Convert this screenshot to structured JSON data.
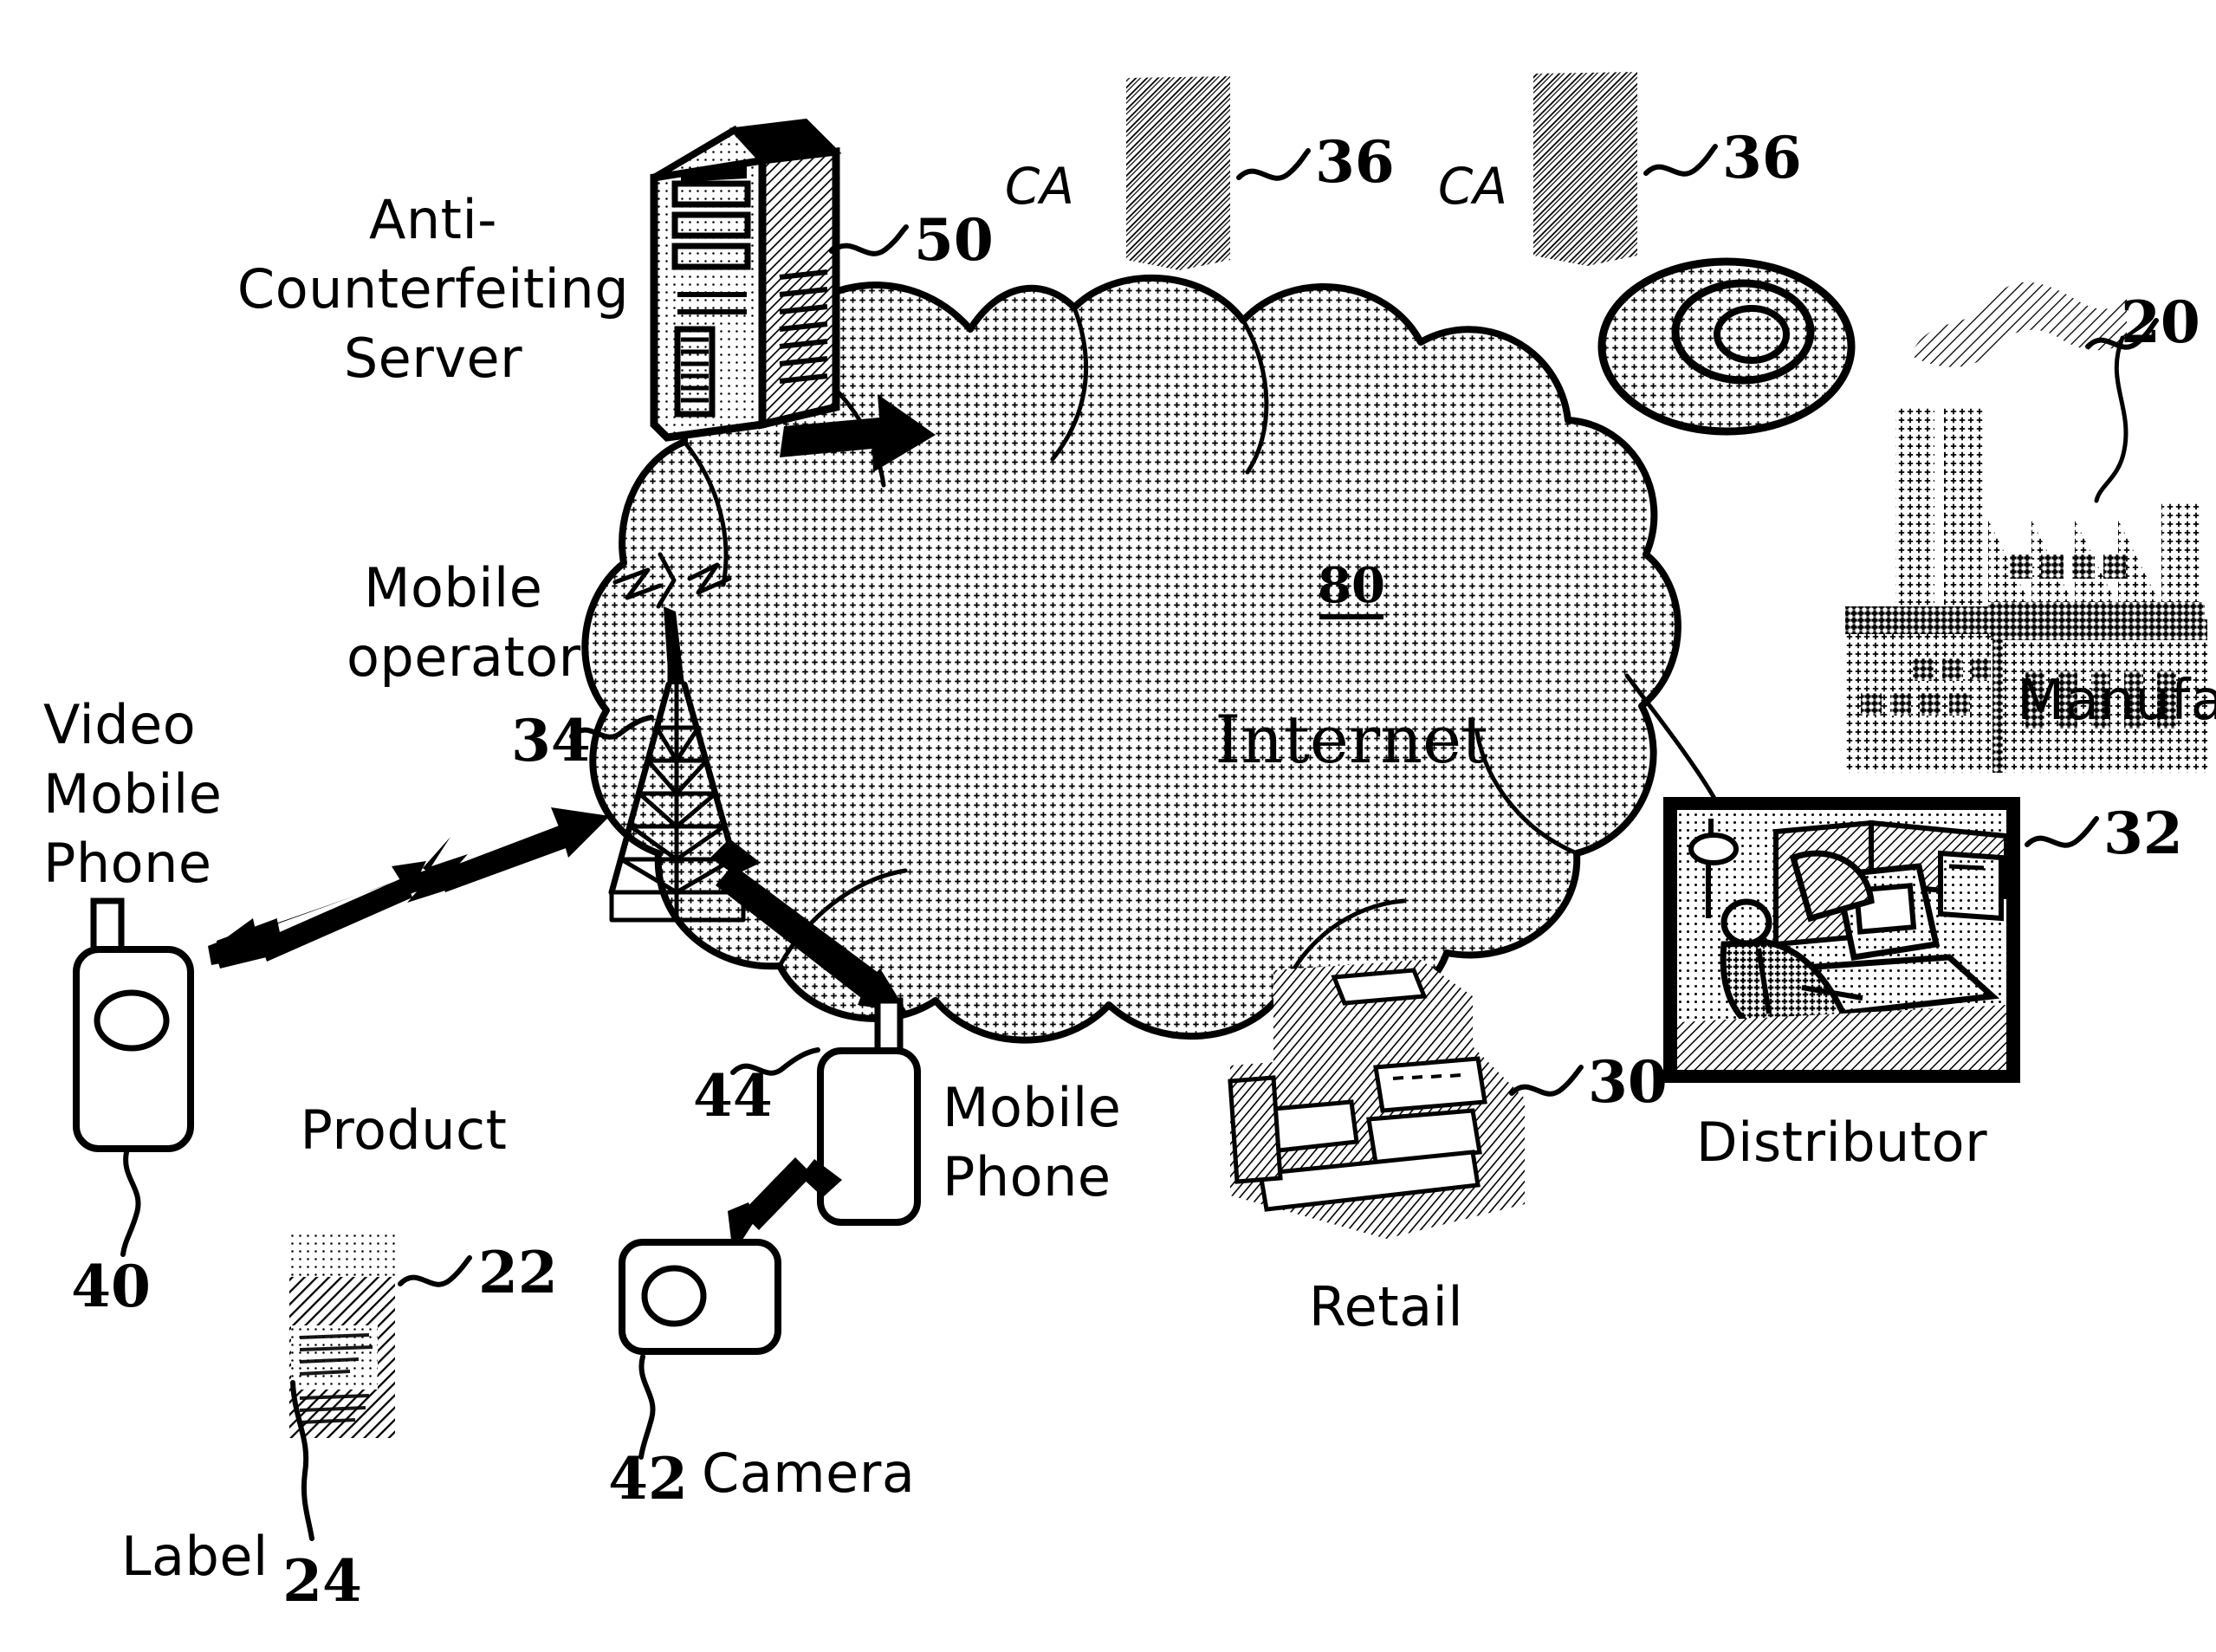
{
  "figure": {
    "kind": "patent-network-diagram",
    "background_color": "#ffffff",
    "ink_color": "#000000"
  },
  "cloud": {
    "name": "Internet",
    "label": "Internet",
    "ref": "80",
    "fill": "halftone-dot"
  },
  "nodes": [
    {
      "id": "server",
      "label": "Anti-\nCounterfeiting\nServer",
      "label_lines": [
        "Anti-",
        "Counterfeiting",
        "Server"
      ],
      "ref": "50",
      "icon": "tower-server-icon"
    },
    {
      "id": "ca_left",
      "label": "CA",
      "ref": "36",
      "icon": "certificate-authority-server-icon"
    },
    {
      "id": "ca_right",
      "label": "CA",
      "ref": "36",
      "icon": "certificate-authority-server-icon"
    },
    {
      "id": "manufacturer",
      "label": "Manufacturer",
      "ref": "20",
      "icon": "factory-icon"
    },
    {
      "id": "distributor",
      "label": "Distributor",
      "ref": "32",
      "icon": "warehouse-office-photo-icon"
    },
    {
      "id": "retail",
      "label": "Retail",
      "ref": "30",
      "icon": "cash-register-icon"
    },
    {
      "id": "mobile_operator",
      "label": "Mobile\noperator",
      "label_lines": [
        "Mobile",
        "operator"
      ],
      "ref": "34",
      "icon": "cell-tower-icon"
    },
    {
      "id": "video_mobile_phone",
      "label": "Video\nMobile\nPhone",
      "label_lines": [
        "Video",
        "Mobile",
        "Phone"
      ],
      "ref": "40",
      "icon": "video-mobile-phone-icon"
    },
    {
      "id": "mobile_phone",
      "label": "Mobile\nPhone",
      "label_lines": [
        "Mobile",
        "Phone"
      ],
      "ref": "44",
      "icon": "mobile-phone-icon"
    },
    {
      "id": "camera",
      "label": "Camera",
      "ref": "42",
      "icon": "camera-icon"
    },
    {
      "id": "product",
      "label": "Product",
      "ref": "22",
      "icon": "product-bottle-icon"
    },
    {
      "id": "label",
      "label": "Label",
      "ref": "24",
      "icon": "product-label-icon"
    }
  ],
  "labels": {
    "server_line1": "Anti-",
    "server_line2": "Counterfeiting",
    "server_line3": "Server",
    "server_ref": "50",
    "ca_left": "CA",
    "ca_left_ref": "36",
    "ca_right": "CA",
    "ca_right_ref": "36",
    "manufacturer": "Manufacturer",
    "manufacturer_ref": "20",
    "distributor": "Distributor",
    "distributor_ref": "32",
    "retail": "Retail",
    "retail_ref": "30",
    "internet": "Internet",
    "internet_ref": "80",
    "mobile_operator_line1": "Mobile",
    "mobile_operator_line2": "operator",
    "mobile_operator_ref": "34",
    "video_phone_line1": "Video",
    "video_phone_line2": "Mobile",
    "video_phone_line3": "Phone",
    "video_phone_ref": "40",
    "mobile_phone_line1": "Mobile",
    "mobile_phone_line2": "Phone",
    "mobile_phone_ref": "44",
    "camera": "Camera",
    "camera_ref": "42",
    "product": "Product",
    "product_ref": "22",
    "label": "Label",
    "label_ref": "24"
  },
  "connections": [
    {
      "from": "server",
      "to": "cloud",
      "style": "thick-solid-arrow",
      "direction": "one-way"
    },
    {
      "from": "ca_left",
      "to": "cloud",
      "style": "overlap",
      "direction": "none"
    },
    {
      "from": "ca_right",
      "to": "cloud",
      "style": "overlap",
      "direction": "none"
    },
    {
      "from": "cloud",
      "to": "distributor",
      "style": "thin-curve",
      "direction": "none"
    },
    {
      "from": "cloud",
      "to": "manufacturer",
      "style": "overlap",
      "direction": "none"
    },
    {
      "from": "cloud",
      "to": "retail",
      "style": "overlap",
      "direction": "none"
    },
    {
      "from": "video_mobile_phone",
      "to": "mobile_operator",
      "style": "double-arrow-zigzag",
      "direction": "two-way"
    },
    {
      "from": "mobile_operator",
      "to": "mobile_phone",
      "style": "double-arrow",
      "direction": "two-way"
    },
    {
      "from": "camera",
      "to": "mobile_phone",
      "style": "double-arrow-small",
      "direction": "two-way"
    },
    {
      "from": "mobile_operator",
      "to": "cloud",
      "style": "radio-waves",
      "direction": "none"
    }
  ]
}
